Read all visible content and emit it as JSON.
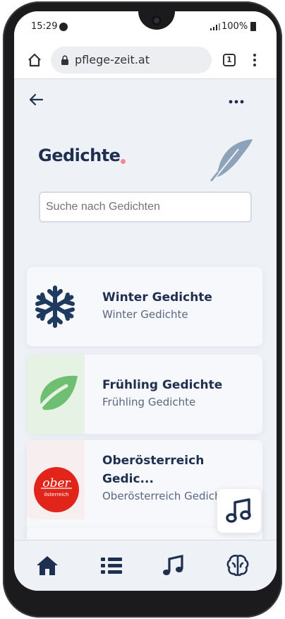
{
  "status_bar": {
    "time": "15:29",
    "battery": "100%"
  },
  "browser": {
    "url": "pflege-zeit.at",
    "tab_count": "1"
  },
  "page": {
    "title": "Gedichte",
    "search": {
      "placeholder": "Suche nach Gedichten"
    },
    "items": [
      {
        "title": "Winter Gedichte",
        "subtitle": "Winter Gedichte",
        "icon": "snowflake-icon"
      },
      {
        "title": "Frühling Gedichte",
        "subtitle": "Frühling Gedichte",
        "icon": "leaf-icon"
      },
      {
        "title": "Oberösterreich Gedic...",
        "subtitle": "Oberösterreich Gedichte",
        "icon": "oberoesterreich-logo",
        "logo_text": "ober",
        "logo_subtext": "österreich"
      }
    ]
  },
  "bottom_nav": [
    "home-icon",
    "list-icon",
    "music-icon",
    "brain-icon"
  ],
  "colors": {
    "title": "#1e2f4f",
    "accent_dot": "#ef8a8e",
    "logo_red": "#e1251b",
    "leaf_green": "#6fbf73"
  }
}
